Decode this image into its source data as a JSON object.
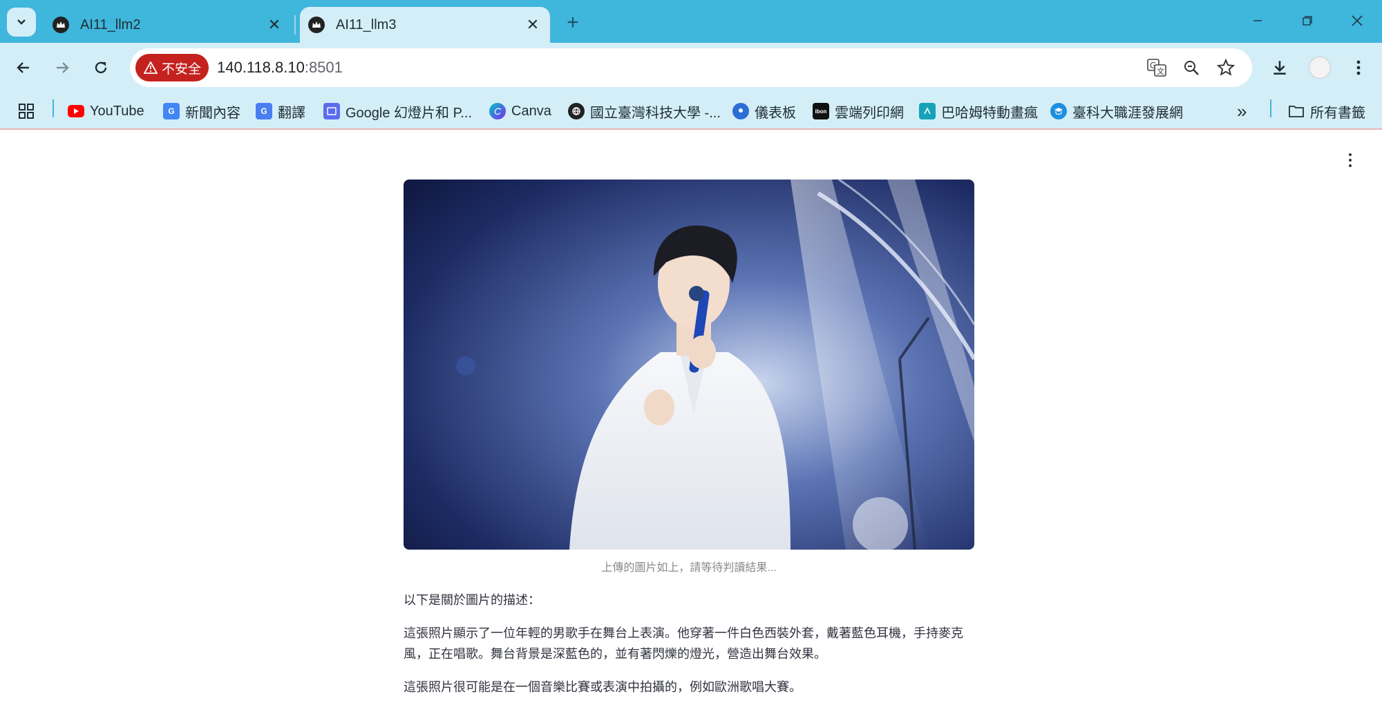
{
  "browser": {
    "tabs": [
      {
        "title": "AI11_llm2",
        "active": false
      },
      {
        "title": "AI11_llm3",
        "active": true
      }
    ],
    "new_tab_glyph": "+",
    "close_glyph": "✕",
    "security_chip": "不安全",
    "url_host": "140.118.8.10",
    "url_port": ":8501"
  },
  "bookmarks": [
    {
      "label": "YouTube",
      "icon": "youtube-icon"
    },
    {
      "label": "新聞內容",
      "icon": "news-icon"
    },
    {
      "label": "翻譯",
      "icon": "translate-icon"
    },
    {
      "label": "Google 幻燈片和 P...",
      "icon": "slides-icon"
    },
    {
      "label": "Canva",
      "icon": "canva-icon"
    },
    {
      "label": "國立臺灣科技大學 -...",
      "icon": "globe-icon"
    },
    {
      "label": "儀表板",
      "icon": "dashboard-icon"
    },
    {
      "label": "雲端列印網",
      "icon": "ibon-icon"
    },
    {
      "label": "巴哈姆特動畫瘋",
      "icon": "bahamut-icon"
    },
    {
      "label": "臺科大職涯發展網",
      "icon": "career-icon"
    }
  ],
  "bookmarks_overflow": "»",
  "all_bookmarks": "所有書籤",
  "content": {
    "image_caption": "上傳的圖片如上，請等待判讀結果...",
    "heading": "以下是關於圖片的描述：",
    "paragraph1": "這張照片顯示了一位年輕的男歌手在舞台上表演。他穿著一件白色西裝外套，戴著藍色耳機，手持麥克風，正在唱歌。舞台背景是深藍色的，並有著閃爍的燈光，營造出舞台效果。",
    "paragraph2": "這張照片很可能是在一個音樂比賽或表演中拍攝的，例如歐洲歌唱大賽。"
  },
  "colors": {
    "tabstrip": "#3fb6dc",
    "toolbar": "#d4eef8",
    "security_chip": "#c5221f"
  }
}
